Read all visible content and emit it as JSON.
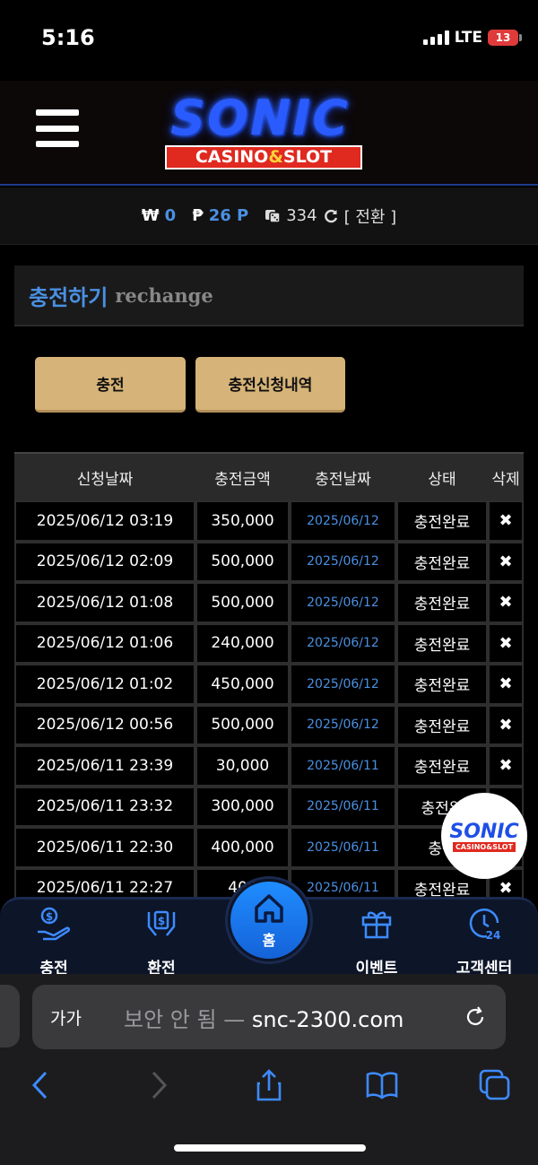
{
  "status_bar": {
    "time": "5:16",
    "network": "LTE",
    "battery": "13"
  },
  "header": {
    "logo_main": "SONIC",
    "logo_sub_1": "CASINO",
    "logo_sub_amp": "&",
    "logo_sub_2": "SLOT"
  },
  "balance": {
    "won_symbol": "₩",
    "won_value": "0",
    "point_symbol": "₱",
    "point_value": "26 P",
    "chip_value": "334",
    "convert_label": "[ 전환 ]"
  },
  "section": {
    "title_ko": "충전하기",
    "title_en": "rechange"
  },
  "tabs": {
    "charge": "충전",
    "history": "충전신청내역"
  },
  "table": {
    "headers": [
      "신청날짜",
      "충전금액",
      "충전날짜",
      "상태",
      "삭제"
    ],
    "rows": [
      {
        "request_date": "2025/06/12 03:19",
        "amount": "350,000",
        "charge_date": "2025/06/12",
        "status": "충전완료",
        "delete": "✖"
      },
      {
        "request_date": "2025/06/12 02:09",
        "amount": "500,000",
        "charge_date": "2025/06/12",
        "status": "충전완료",
        "delete": "✖"
      },
      {
        "request_date": "2025/06/12 01:08",
        "amount": "500,000",
        "charge_date": "2025/06/12",
        "status": "충전완료",
        "delete": "✖"
      },
      {
        "request_date": "2025/06/12 01:06",
        "amount": "240,000",
        "charge_date": "2025/06/12",
        "status": "충전완료",
        "delete": "✖"
      },
      {
        "request_date": "2025/06/12 01:02",
        "amount": "450,000",
        "charge_date": "2025/06/12",
        "status": "충전완료",
        "delete": "✖"
      },
      {
        "request_date": "2025/06/12 00:56",
        "amount": "500,000",
        "charge_date": "2025/06/12",
        "status": "충전완료",
        "delete": "✖"
      },
      {
        "request_date": "2025/06/11 23:39",
        "amount": "30,000",
        "charge_date": "2025/06/11",
        "status": "충전완료",
        "delete": "✖"
      },
      {
        "request_date": "2025/06/11 23:32",
        "amount": "300,000",
        "charge_date": "2025/06/11",
        "status": "충전완",
        "delete": ""
      },
      {
        "request_date": "2025/06/11 22:30",
        "amount": "400,000",
        "charge_date": "2025/06/11",
        "status": "충전",
        "delete": ""
      },
      {
        "request_date": "2025/06/11 22:27",
        "amount": "400",
        "charge_date": "2025/06/11",
        "status": "충전완료",
        "delete": "✖"
      }
    ]
  },
  "floating_logo": {
    "main": "SONIC",
    "sub": "CASINO&SLOT"
  },
  "bottom_nav": {
    "charge": "충전",
    "exchange": "환전",
    "home": "홈",
    "event": "이벤트",
    "support": "고객센터"
  },
  "browser": {
    "aa_label": "가가",
    "insecure_label": "보안 안 됨 —",
    "domain": "snc-2300.com"
  },
  "colors": {
    "accent_blue": "#4a90e2",
    "gold_button": "#d6b378",
    "nav_bg": "#0d1528"
  }
}
